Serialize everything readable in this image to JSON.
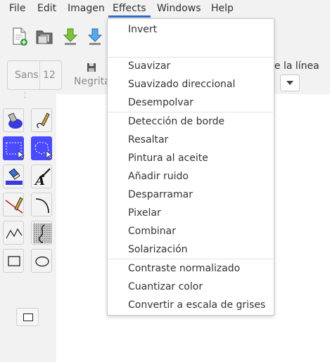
{
  "menubar": {
    "items": [
      {
        "label": "File"
      },
      {
        "label": "Edit"
      },
      {
        "label": "Imagen"
      },
      {
        "label": "Effects"
      },
      {
        "label": "Windows"
      },
      {
        "label": "Help"
      }
    ],
    "active": "Effects",
    "accent": "#2f6cc6"
  },
  "toolbar": {
    "icons": [
      "new-file-icon",
      "open-folder-icon",
      "download-green-icon",
      "download-blue-icon"
    ]
  },
  "text_toolbar": {
    "font_name": "Sans",
    "font_size": "12",
    "bold_label": "Negrita",
    "right_label": "le la línea"
  },
  "effects_menu": {
    "items": [
      {
        "label": "Invert"
      },
      {
        "label": "Suavizar"
      },
      {
        "label": "Suavizado direccional"
      },
      {
        "label": "Desempolvar"
      },
      {
        "label": "Detección de borde"
      },
      {
        "label": "Resaltar"
      },
      {
        "label": "Pintura al aceite"
      },
      {
        "label": "Añadir ruido"
      },
      {
        "label": "Desparramar"
      },
      {
        "label": "Pixelar"
      },
      {
        "label": "Combinar"
      },
      {
        "label": "Solarización"
      },
      {
        "label": "Contraste normalizado"
      },
      {
        "label": "Cuantizar color"
      },
      {
        "label": "Convertir a escala de grises"
      }
    ]
  },
  "tools": [
    "fill-bucket-icon",
    "pencil-icon",
    "rect-select-icon",
    "free-select-icon",
    "eraser-icon",
    "text-icon",
    "line-icon",
    "curve-icon",
    "polyline-icon",
    "freeform-icon",
    "rectangle-icon",
    "ellipse-icon"
  ],
  "colors": {
    "selected_tool": "#4a4aff",
    "canvas": "#ffffff"
  }
}
